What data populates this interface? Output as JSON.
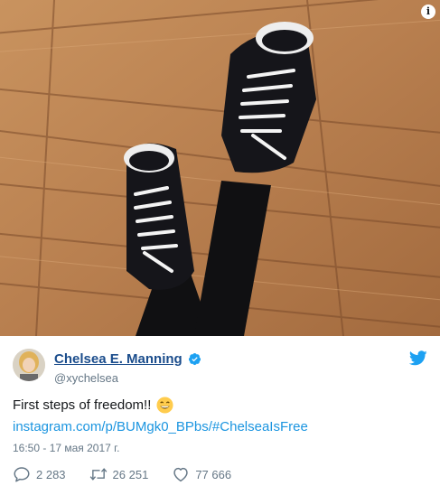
{
  "photo": {
    "info_glyph": "i",
    "colors": {
      "floor_light": "#c48c5c",
      "floor_dark": "#8a5634",
      "shoe": "#15151a",
      "lace": "#f4f4f4",
      "pants": "#101012"
    }
  },
  "author": {
    "display_name": "Chelsea E. Manning",
    "handle": "@xychelsea",
    "verified": true
  },
  "tweet": {
    "text": "First steps of freedom!!",
    "emoji": "grinning-face-smiling-eyes",
    "link": "instagram.com/p/BUMgk0_BPbs/#ChelseaIsFree",
    "timestamp": "16:50 - 17 мая 2017 г."
  },
  "actions": {
    "replies": "2 283",
    "retweets": "26 251",
    "likes": "77 666"
  },
  "colors": {
    "link": "#1b95e0",
    "name": "#1b4d8c",
    "muted": "#657786",
    "verified": "#1da1f2"
  }
}
